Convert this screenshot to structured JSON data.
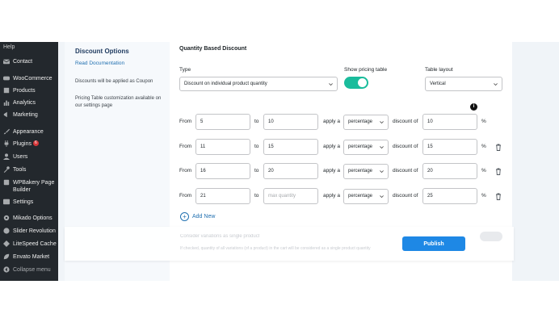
{
  "wp_menu": {
    "help": "Help",
    "items": [
      {
        "label": "Contact",
        "icon": "mail-icon"
      },
      {
        "label": "WooCommerce",
        "icon": "woocommerce-icon"
      },
      {
        "label": "Products",
        "icon": "box-icon"
      },
      {
        "label": "Analytics",
        "icon": "bar-chart-icon"
      },
      {
        "label": "Marketing",
        "icon": "megaphone-icon"
      },
      {
        "label": "Appearance",
        "icon": "brush-icon"
      },
      {
        "label": "Plugins",
        "icon": "plug-icon",
        "badge": "6"
      },
      {
        "label": "Users",
        "icon": "user-icon"
      },
      {
        "label": "Tools",
        "icon": "wrench-icon"
      },
      {
        "label": "WPBakery Page Builder",
        "icon": "builder-icon"
      },
      {
        "label": "Settings",
        "icon": "settings-icon"
      },
      {
        "label": "Mikado Options",
        "icon": "gear-icon"
      },
      {
        "label": "Slider Revolution",
        "icon": "slider-icon"
      },
      {
        "label": "LiteSpeed Cache",
        "icon": "diamond-icon"
      },
      {
        "label": "Envato Market",
        "icon": "leaf-icon"
      },
      {
        "label": "Collapse menu",
        "icon": "collapse-icon"
      }
    ]
  },
  "left_panel": {
    "title": "Discount Options",
    "read_docs": "Read Documentation",
    "coupon_note": "Discounts will be applied as Coupon",
    "table_note": "Pricing Table customization available on our settings page"
  },
  "main": {
    "section_title": "Quantity Based Discount",
    "type_label": "Type",
    "type_value": "Discount on individual product quantity",
    "show_pricing_label": "Show pricing table",
    "show_pricing_on": true,
    "layout_label": "Table layout",
    "layout_value": "Vertical",
    "rows": [
      {
        "from_label": "From",
        "from": "5",
        "to_label": "to",
        "to": "10",
        "to_placeholder": "",
        "apply_label": "apply a",
        "kind": "percentage",
        "discount_label": "discount of",
        "discount": "10",
        "unit": "%"
      },
      {
        "from_label": "From",
        "from": "11",
        "to_label": "to",
        "to": "15",
        "to_placeholder": "",
        "apply_label": "apply a",
        "kind": "percentage",
        "discount_label": "discount of",
        "discount": "15",
        "unit": "%"
      },
      {
        "from_label": "From",
        "from": "16",
        "to_label": "to",
        "to": "20",
        "to_placeholder": "",
        "apply_label": "apply a",
        "kind": "percentage",
        "discount_label": "discount of",
        "discount": "20",
        "unit": "%"
      },
      {
        "from_label": "From",
        "from": "21",
        "to_label": "to",
        "to": "",
        "to_placeholder": "max quantity",
        "apply_label": "apply a",
        "kind": "percentage",
        "discount_label": "discount of",
        "discount": "25",
        "unit": "%"
      }
    ],
    "add_new": "Add New",
    "info_icon_glyph": "i"
  },
  "footer": {
    "variations_label": "Consider variations as single product",
    "variations_note": "If checked, quantity of all variations (of a product) in the cart will be considered as a single product quantity",
    "publish": "Publish"
  }
}
